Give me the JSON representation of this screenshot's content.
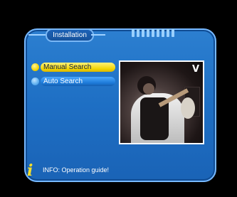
{
  "header": {
    "title": "Installation"
  },
  "menu": {
    "items": [
      {
        "label": "Manual Search",
        "state": "selected"
      },
      {
        "label": "Auto Search",
        "state": "normal"
      }
    ]
  },
  "preview": {
    "channel_logo_left": "",
    "channel_logo_right": "V"
  },
  "info": {
    "text": "INFO: Operation guide!"
  },
  "colors": {
    "panel": "#1e6fc4",
    "border": "#77b9ff",
    "highlight": "#f2d400",
    "menu_inactive": "#1c78d6"
  },
  "icons": {
    "info": "info-i-icon"
  }
}
